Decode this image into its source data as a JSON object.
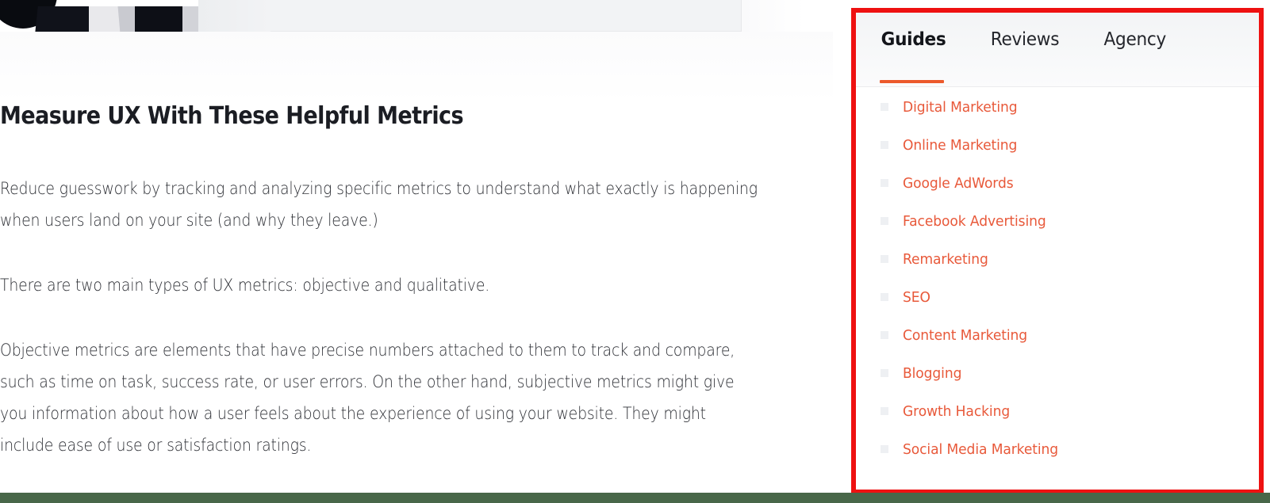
{
  "article": {
    "hero_image_alt": "cropped black and white photo of a person in a suit",
    "title": "Measure UX With These Helpful Metrics",
    "paragraphs": [
      "Reduce guesswork by tracking and analyzing specific metrics to understand what exactly is happening when users land on your site (and why they leave.)",
      "There are two main types of UX metrics: objective and qualitative.",
      "Objective metrics are elements that have precise numbers attached to them to track and compare, such as time on task, success rate, or user errors. On the other hand, subjective metrics might give you information about how a user feels about the experience of using your website. They might include ease of use or satisfaction ratings."
    ]
  },
  "sidebar": {
    "tabs": [
      {
        "label": "Guides",
        "active": true
      },
      {
        "label": "Reviews",
        "active": false
      },
      {
        "label": "Agency",
        "active": false
      }
    ],
    "active_tab_accent": "#ec5a2c",
    "link_color": "#e8593a",
    "bullet_icon": "square-bullet-icon",
    "links": [
      "Digital Marketing",
      "Online Marketing",
      "Google AdWords",
      "Facebook Advertising",
      "Remarketing",
      "SEO",
      "Content Marketing",
      "Blogging",
      "Growth Hacking",
      "Social Media Marketing"
    ]
  },
  "annotation": {
    "type": "highlight-rectangle",
    "color": "#ee1111"
  },
  "bottom_bar": {
    "color": "#486749"
  }
}
